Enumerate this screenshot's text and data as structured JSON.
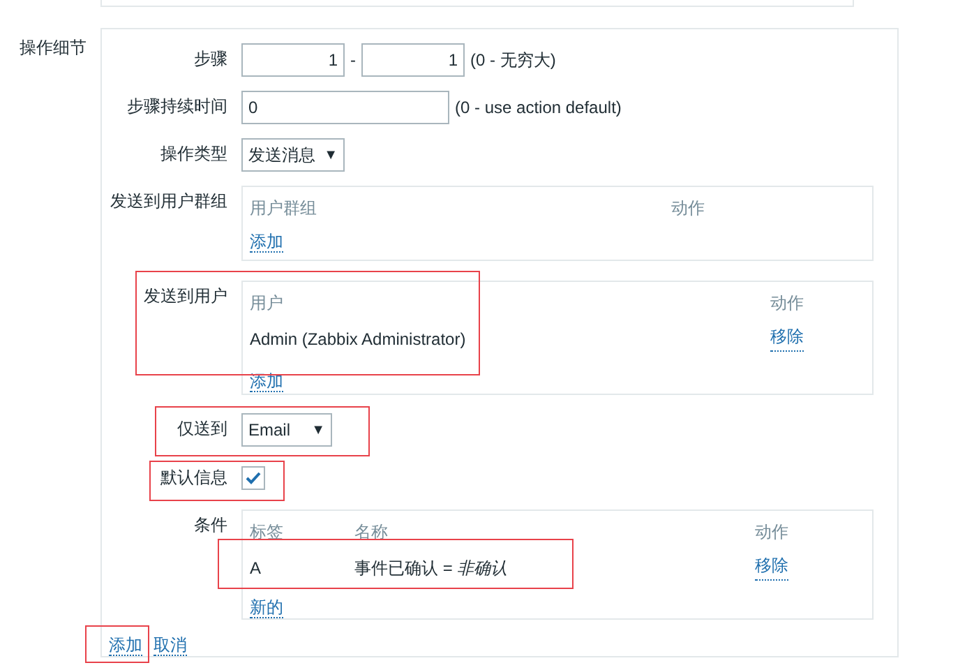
{
  "section_label": "操作细节",
  "steps": {
    "label": "步骤",
    "from": "1",
    "separator": "-",
    "to": "1",
    "hint": "(0 - 无穷大)"
  },
  "step_duration": {
    "label": "步骤持续时间",
    "value": "0",
    "hint": "(0 - use action default)"
  },
  "operation_type": {
    "label": "操作类型",
    "value": "发送消息",
    "arrow": "▼"
  },
  "send_to_groups": {
    "label": "发送到用户群组",
    "columns": [
      "用户群组",
      "动作"
    ],
    "add_link": "添加"
  },
  "send_to_users": {
    "label": "发送到用户",
    "columns": [
      "用户",
      "动作"
    ],
    "rows": [
      {
        "user": "Admin (Zabbix Administrator)",
        "action": "移除"
      }
    ],
    "add_link": "添加"
  },
  "send_only_to": {
    "label": "仅送到",
    "value": "Email",
    "arrow": "▼"
  },
  "default_message": {
    "label": "默认信息",
    "checked": true
  },
  "conditions": {
    "label": "条件",
    "columns": [
      "标签",
      "名称",
      "动作"
    ],
    "rows": [
      {
        "label": "A",
        "name": "事件已确认 = *非确认*",
        "action": "移除"
      }
    ],
    "new_link": "新的"
  },
  "footer_links": [
    "添加",
    "取消"
  ]
}
